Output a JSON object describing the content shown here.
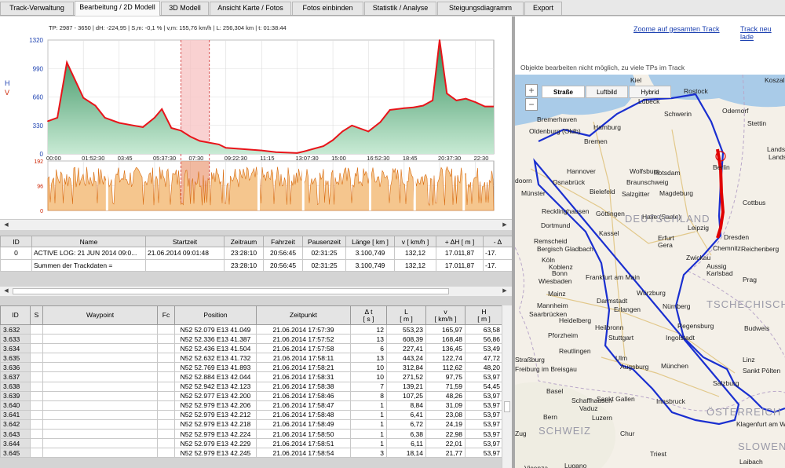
{
  "tabs": [
    "Track-Verwaltung",
    "Bearbeitung / 2D Modell",
    "3D Modell",
    "Ansicht Karte / Fotos",
    "Fotos einbinden",
    "Statistik / Analyse",
    "Steigungsdiagramm",
    "Export"
  ],
  "chart": {
    "info": "TP: 2987 - 3650 | dH: -224,95  | S,m: -0,1 % | v,m: 155,76 km/h | L: 256,304 km | t: 01:38:44",
    "axis_letters": [
      "H",
      "V"
    ],
    "h_ticks": [
      "1320",
      "990",
      "660",
      "330",
      "0"
    ],
    "v_ticks": [
      "192",
      "96",
      "0"
    ],
    "time_ticks": [
      "00:00",
      "01:52:30",
      "03:45",
      "05:37:30",
      "07:30",
      "09:22:30",
      "11:15",
      "13:07:30",
      "15:00",
      "16:52:30",
      "18:45",
      "20:37:30",
      "22:30"
    ]
  },
  "chart_data": {
    "type": "area",
    "ylabel": "H",
    "ylim": [
      0,
      1320
    ],
    "x": [
      "00:00",
      "00:30",
      "01:00",
      "01:52",
      "02:30",
      "03:00",
      "03:45",
      "04:30",
      "05:00",
      "05:37",
      "06:00",
      "06:30",
      "07:00",
      "07:30",
      "08:00",
      "09:00",
      "09:22",
      "10:00",
      "11:15",
      "12:00",
      "13:07",
      "13:30",
      "14:00",
      "14:30",
      "15:00",
      "15:30",
      "16:00",
      "16:52",
      "17:30",
      "18:00",
      "18:45",
      "19:15",
      "19:45",
      "20:15",
      "20:37",
      "21:00",
      "21:30",
      "22:00",
      "22:30",
      "23:00"
    ],
    "series": [
      {
        "name": "H",
        "values": [
          380,
          420,
          1060,
          650,
          560,
          420,
          360,
          330,
          310,
          420,
          520,
          300,
          270,
          200,
          150,
          110,
          70,
          60,
          40,
          20,
          10,
          30,
          60,
          90,
          160,
          260,
          330,
          260,
          370,
          510,
          530,
          540,
          560,
          620,
          1320,
          700,
          620,
          640,
          600,
          550
        ]
      }
    ],
    "speed_ylim": [
      0,
      192
    ],
    "selection": {
      "start": "07:00",
      "end": "08:30"
    }
  },
  "summary": {
    "headers": [
      "ID",
      "Name",
      "Startzeit",
      "Zeitraum",
      "Fahrzeit",
      "Pausenzeit",
      "Länge  [ km ]",
      "v  [ km/h ]",
      "+ ΔH  [ m ]",
      "- Δ"
    ],
    "rows": [
      [
        "0",
        "ACTIVE LOG: 21 JUN 2014 09:0...",
        "21.06.2014 09:01:48",
        "23:28:10",
        "20:56:45",
        "02:31:25",
        "3.100,749",
        "132,12",
        "17.011,87",
        "-17."
      ],
      [
        "",
        "Summen der Trackdaten =",
        "",
        "23:28:10",
        "20:56:45",
        "02:31:25",
        "3.100,749",
        "132,12",
        "17.011,87",
        "-17."
      ]
    ]
  },
  "waypoints": {
    "headers": [
      "ID",
      "S",
      "Waypoint",
      "Fc",
      "Position",
      "Zeitpunkt",
      "Δ t\n[ s ]",
      "L\n[ m ]",
      "v\n[ km/h ]",
      "H\n[ m ]"
    ],
    "rows": [
      [
        "3.632",
        "",
        "",
        "",
        "N52 52.079 E13 41.049",
        "21.06.2014 17:57:39",
        "12",
        "553,23",
        "165,97",
        "63,58"
      ],
      [
        "3.633",
        "",
        "",
        "",
        "N52 52.336 E13 41.387",
        "21.06.2014 17:57:52",
        "13",
        "608,39",
        "168,48",
        "56,86"
      ],
      [
        "3.634",
        "",
        "",
        "",
        "N52 52.436 E13 41.504",
        "21.06.2014 17:57:58",
        "6",
        "227,41",
        "136,45",
        "53,49"
      ],
      [
        "3.635",
        "",
        "",
        "",
        "N52 52.632 E13 41.732",
        "21.06.2014 17:58:11",
        "13",
        "443,24",
        "122,74",
        "47,72"
      ],
      [
        "3.636",
        "",
        "",
        "",
        "N52 52.769 E13 41.893",
        "21.06.2014 17:58:21",
        "10",
        "312,84",
        "112,62",
        "48,20"
      ],
      [
        "3.637",
        "",
        "",
        "",
        "N52 52.884 E13 42.044",
        "21.06.2014 17:58:31",
        "10",
        "271,52",
        "97,75",
        "53,97"
      ],
      [
        "3.638",
        "",
        "",
        "",
        "N52 52.942 E13 42.123",
        "21.06.2014 17:58:38",
        "7",
        "139,21",
        "71,59",
        "54,45"
      ],
      [
        "3.639",
        "",
        "",
        "",
        "N52 52.977 E13 42.200",
        "21.06.2014 17:58:46",
        "8",
        "107,25",
        "48,26",
        "53,97"
      ],
      [
        "3.640",
        "",
        "",
        "",
        "N52 52.979 E13 42.206",
        "21.06.2014 17:58:47",
        "1",
        "8,84",
        "31,09",
        "53,97"
      ],
      [
        "3.641",
        "",
        "",
        "",
        "N52 52.979 E13 42.212",
        "21.06.2014 17:58:48",
        "1",
        "6,41",
        "23,08",
        "53,97"
      ],
      [
        "3.642",
        "",
        "",
        "",
        "N52 52.979 E13 42.218",
        "21.06.2014 17:58:49",
        "1",
        "6,72",
        "24,19",
        "53,97"
      ],
      [
        "3.643",
        "",
        "",
        "",
        "N52 52.979 E13 42.224",
        "21.06.2014 17:58:50",
        "1",
        "6,38",
        "22,98",
        "53,97"
      ],
      [
        "3.644",
        "",
        "",
        "",
        "N52 52.979 E13 42.229",
        "21.06.2014 17:58:51",
        "1",
        "6,11",
        "22,01",
        "53,97"
      ],
      [
        "3.645",
        "",
        "",
        "",
        "N52 52.979 E13 42.245",
        "21.06.2014 17:58:54",
        "3",
        "18,14",
        "21,77",
        "53,97"
      ]
    ]
  },
  "map": {
    "zoom_link": "Zoome auf gesamten Track",
    "reload_link": "Track neu lade",
    "info": "Objekte bearbeiten nicht möglich, zu viele TPs im Track",
    "tabs": [
      "Straße",
      "Luftbild",
      "Hybrid"
    ],
    "zoom_in": "+",
    "zoom_out": "−",
    "places": [
      "Kiel",
      "Rostock",
      "Koszal",
      "Lübeck",
      "Bremerhaven",
      "Schwerin",
      "Hamburg",
      "Oldenburg (Oldb)",
      "Bremen",
      "Stettin",
      "Odernorf",
      "Landsb",
      "Lands",
      "Berlin",
      "Potsdam",
      "Wolfsburg",
      "Hannover",
      "Osnabrück",
      "Bielefeld",
      "Braunschweig",
      "Magdeburg",
      "Salzgitter",
      "Münster",
      "doorn",
      "Recklinghausen",
      "Göttingen",
      "Halle (Saale)",
      "Dortmund",
      "Kassel",
      "Leipzig",
      "Cottbus",
      "Dresden",
      "Remscheid",
      "Bergisch Gladbach",
      "Köln",
      "Erfurt",
      "Gera",
      "Chemnitz",
      "Zwickau",
      "Aussig",
      "Reichenberg",
      "Bonn",
      "Koblenz",
      "Karlsbad",
      "Prag",
      "Wiesbaden",
      "Frankfurt am Main",
      "Würzburg",
      "Mainz",
      "Darmstadt",
      "Mannheim",
      "Erlangen",
      "Nürnberg",
      "Saarbrücken",
      "Heidelberg",
      "Heilbronn",
      "Pforzheim",
      "Stuttgart",
      "Ingolstadt",
      "Regensburg",
      "Budweis",
      "Straßburg",
      "Reutlingen",
      "Freiburg im Breisgau",
      "Ulm",
      "Augsburg",
      "München",
      "Linz",
      "Sankt Pölten",
      "Salzburg",
      "Basel",
      "Schaffhausen",
      "Sankt Gallen",
      "Vaduz",
      "Innsbruck",
      "Luzern",
      "Bern",
      "Zug",
      "Chur",
      "Klagenfurt am Wörthersee",
      "Laibach",
      "Triest",
      "Lugano",
      "Vicenza",
      "DEUTSCHLAND",
      "TSCHECHISCH",
      "ÖSTERREICH",
      "SCHWEIZ",
      "SLOWEN"
    ]
  }
}
